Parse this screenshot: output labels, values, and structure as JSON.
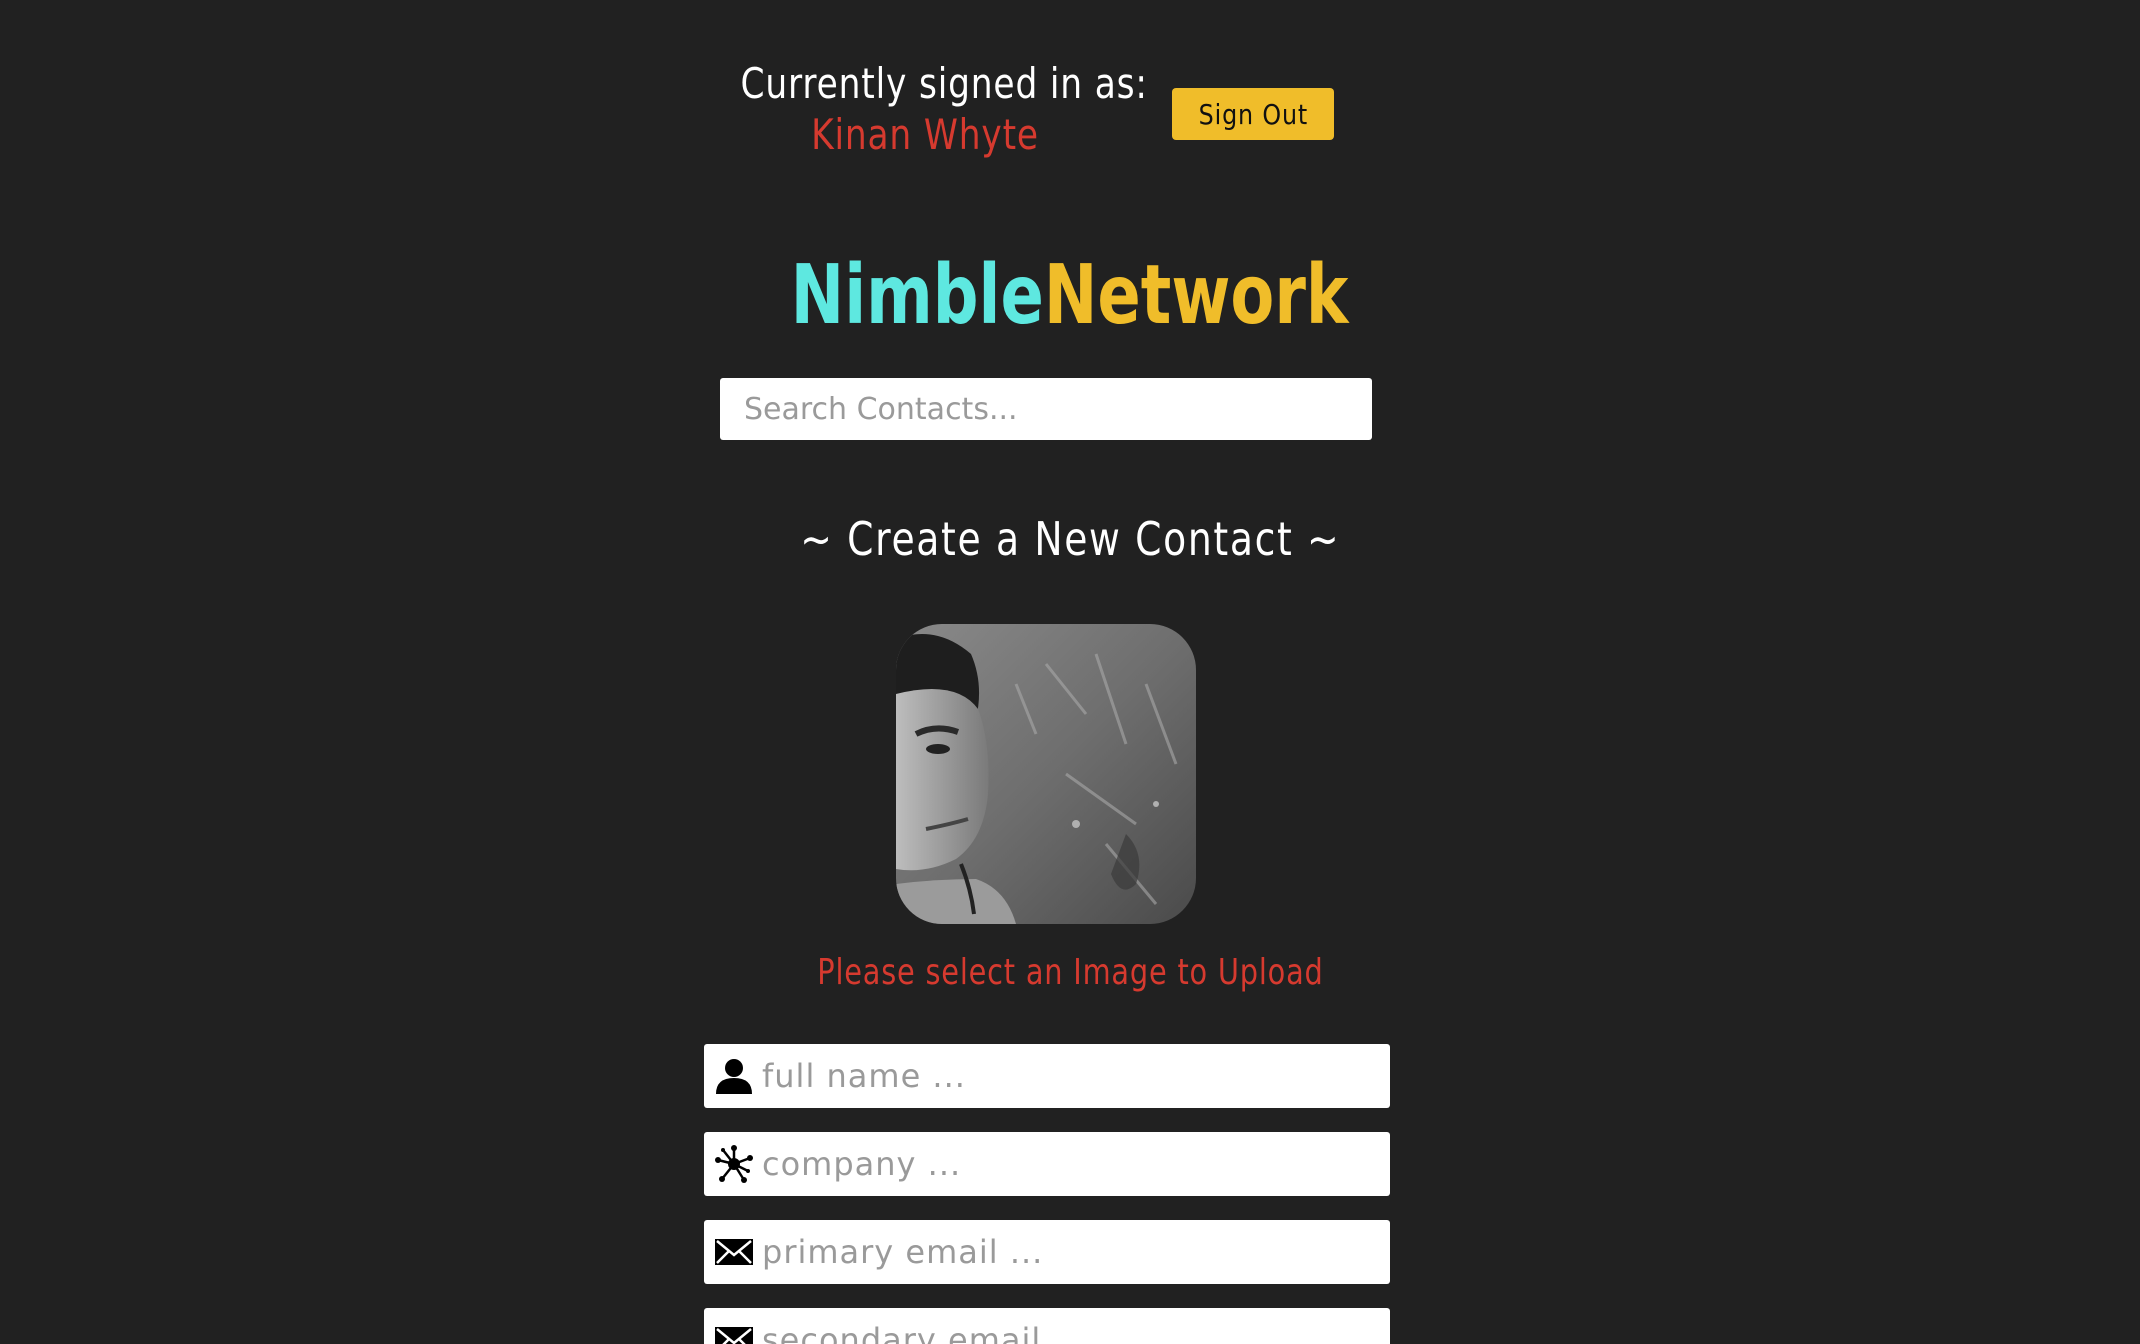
{
  "header": {
    "signed_in_label": "Currently signed in as:",
    "user_name": "Kinan Whyte",
    "sign_out_label": "Sign Out"
  },
  "brand": {
    "part1": "Nimble",
    "part2": "Network"
  },
  "search": {
    "placeholder": "Search Contacts..."
  },
  "create_section": {
    "title": "~ Create a New Contact ~",
    "upload_message": "Please select an Image to Upload"
  },
  "form": {
    "fields": [
      {
        "placeholder": "full name ...",
        "icon": "person-icon"
      },
      {
        "placeholder": "company ...",
        "icon": "network-icon"
      },
      {
        "placeholder": "primary email ...",
        "icon": "envelope-icon"
      },
      {
        "placeholder": "secondary email ...",
        "icon": "envelope-icon"
      }
    ]
  },
  "colors": {
    "background": "#212121",
    "accent_yellow": "#f0bd2a",
    "accent_cyan": "#5ee8e0",
    "accent_red": "#d63a2f"
  }
}
